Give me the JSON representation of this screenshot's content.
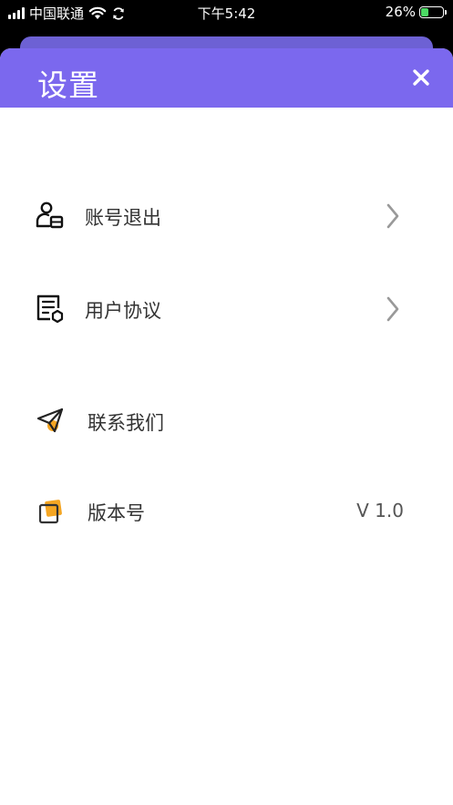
{
  "status_bar": {
    "carrier": "中国联通",
    "time": "下午5:42",
    "battery": "26%"
  },
  "header": {
    "title": "设置"
  },
  "menu": [
    {
      "label": "账号退出",
      "icon": "account-logout-icon"
    },
    {
      "label": "用户协议",
      "icon": "document-icon"
    },
    {
      "label": "联系我们",
      "icon": "paper-plane-icon"
    },
    {
      "label": "版本号",
      "icon": "version-icon",
      "value": "V 1.0"
    }
  ],
  "colors": {
    "header": "#7b68ee",
    "accent": "#f5a623"
  }
}
